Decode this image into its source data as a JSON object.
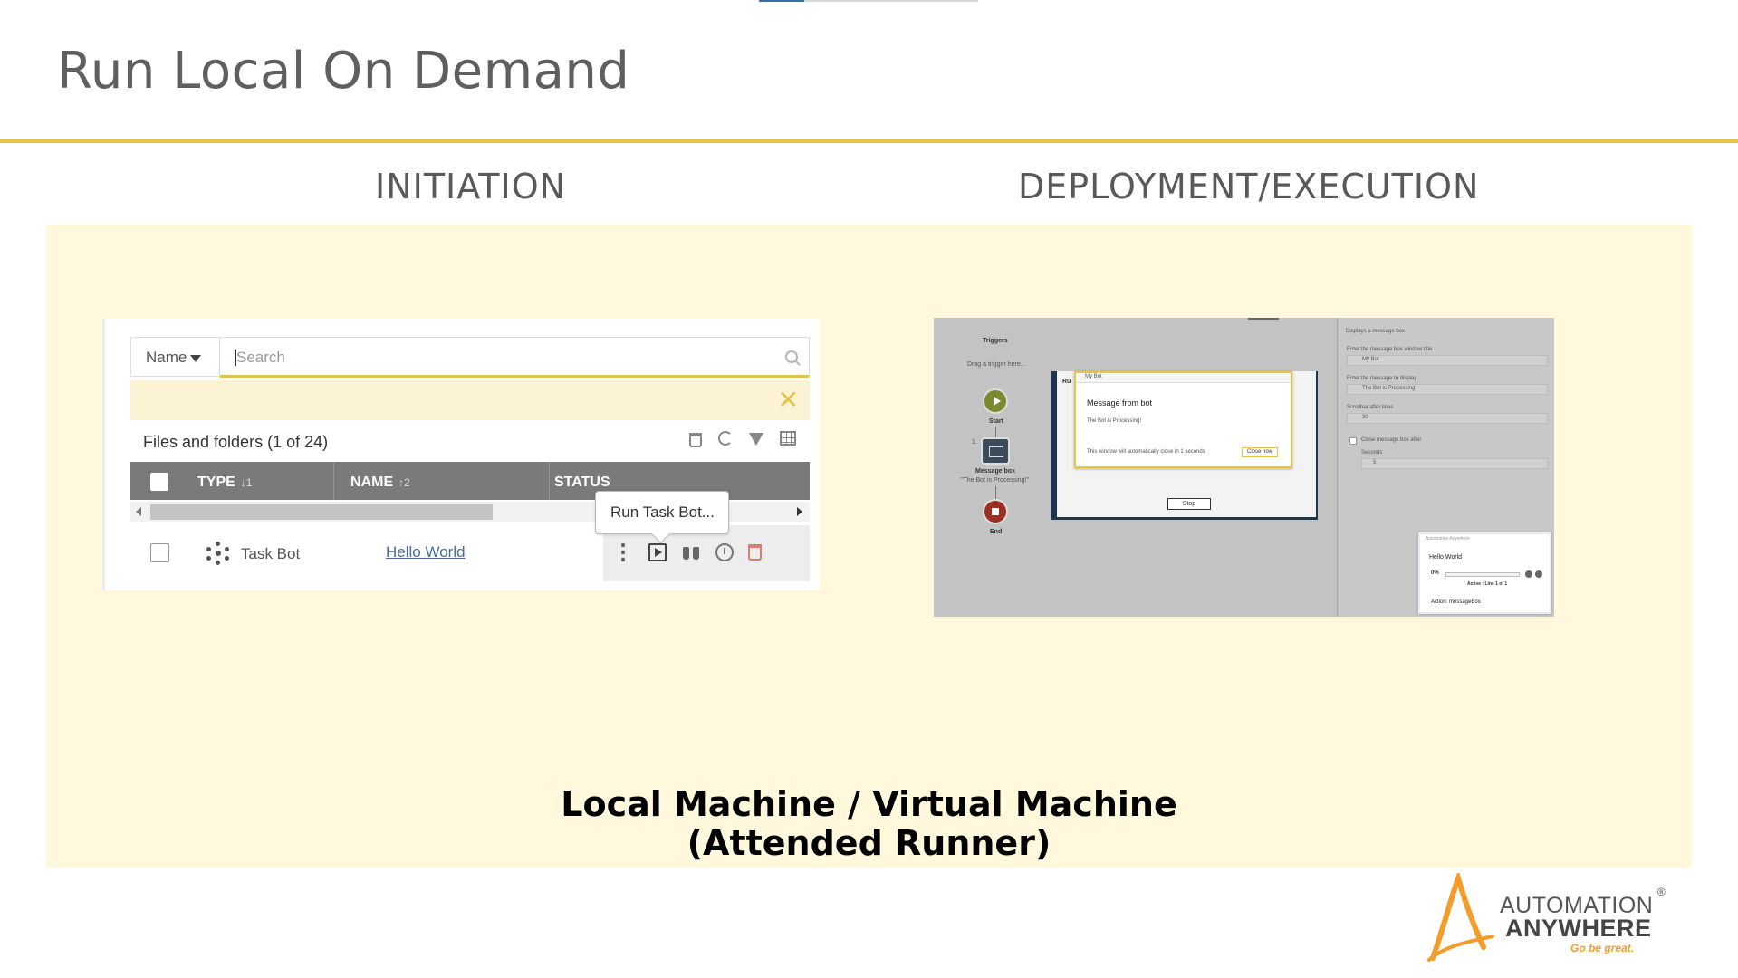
{
  "slide": {
    "title": "Run Local On Demand",
    "col_left_heading": "INITIATION",
    "col_right_heading": "DEPLOYMENT/EXECUTION",
    "footer_line1": "Local Machine / Virtual Machine",
    "footer_line2": "(Attended Runner)",
    "accent_color": "#e8c547",
    "panel_color": "#fff8dc"
  },
  "initiation": {
    "search_field_dropdown": "Name",
    "search_placeholder": "Search",
    "files_label": "Files and folders  (1 of 24)",
    "columns": [
      {
        "label": "TYPE",
        "sort": "↓1"
      },
      {
        "label": "NAME",
        "sort": "↑2"
      },
      {
        "label": "STATUS",
        "sort": ""
      }
    ],
    "row": {
      "type": "Task Bot",
      "name": "Hello World"
    },
    "tooltip": "Run Task Bot...",
    "icons": [
      "search-icon",
      "close-icon",
      "trash-icon",
      "refresh-icon",
      "filter-icon",
      "grid-icon",
      "more-icon",
      "play-icon",
      "binoculars-icon",
      "clock-icon",
      "delete-icon"
    ]
  },
  "execution": {
    "triggers_label": "Triggers",
    "drag_hint": "Drag a trigger here...",
    "start_label": "Start",
    "node_index": "1.",
    "msgbox_label": "Message box",
    "msgbox_sub": "\"The Bot is Processing!\"",
    "end_label": "End",
    "window_prefix": "Ru",
    "dialog_title_bar": "My Bot",
    "dialog_title": "Message from bot",
    "dialog_body": "The Bot is Processing!",
    "dialog_footer": "This window will automatically close in 1 seconds",
    "close_now": "Close now",
    "stop": "Stop",
    "right_header": "Displays a message box",
    "field1_label": "Enter the message box window title",
    "field1_value": "My Bot",
    "field2_label": "Enter the message to display",
    "field2_value": "The Bot is Processing!",
    "field3_label": "Scrollbar after lines",
    "field3_value": "30",
    "checkbox_label": "Close message box after",
    "seconds_label": "Seconds",
    "seconds_value": "5",
    "progress_title_bar": "Automation Anywhere",
    "progress_bot": "Hello World",
    "progress_pct": "0%",
    "progress_fraction": 0,
    "progress_active": "Active : Line 1 of 1",
    "progress_action": "Action: messageBox"
  },
  "logo": {
    "line1": "AUTOMATION",
    "line2": "ANYWHERE",
    "tagline": "Go be great.",
    "reg": "®",
    "colors": [
      "#f39c2a",
      "#444444"
    ]
  }
}
